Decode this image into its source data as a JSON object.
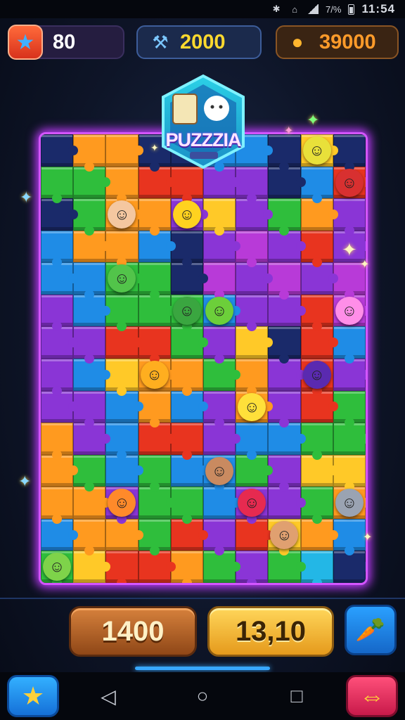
{
  "status_bar": {
    "battery_percent": "7/%",
    "time": "11:54"
  },
  "hud": {
    "stars": {
      "icon": "star-icon",
      "value": "80"
    },
    "gems": {
      "icon": "hammer-icon",
      "value": "2000"
    },
    "coins": {
      "icon": "coin-pot-icon",
      "value": "39000"
    }
  },
  "logo": {
    "title": "PUZZZIA"
  },
  "board": {
    "columns": 10,
    "rows": 14,
    "palette": {
      "G": "#2fbe3c",
      "O": "#ff9a1f",
      "Y": "#ffc928",
      "P": "#8a35d6",
      "B": "#1f8ce6",
      "R": "#e8341f",
      "D": "#1a2a6a",
      "M": "#b83ad8",
      "C": "#23b7e6"
    },
    "cells": [
      "DOODDBBDYD",
      "GGORRPPDBR",
      "DGOOPYPGOP",
      "BOOBDPMPRP",
      "BBGGDMPMPM",
      "PBGGGBPPRM",
      "PPRRGPYDRB",
      "PBYOOGOPRP",
      "PPBOBPOPRG",
      "OPBRRPBBGG",
      "OGBGBBGPYY",
      "OOPGGBPPGO",
      "BOOGRPRYOB",
      "GYRROGPGCD"
    ],
    "characters": [
      {
        "icon": "girl-character-icon",
        "row": 2,
        "col": 2,
        "color": "#f4c7a0"
      },
      {
        "icon": "bell-character-icon",
        "row": 2,
        "col": 4,
        "color": "#ffd21f"
      },
      {
        "icon": "yellow-monster-icon",
        "row": 0,
        "col": 8,
        "color": "#e8e03a"
      },
      {
        "icon": "red-hat-creature-icon",
        "row": 1,
        "col": 9,
        "color": "#d83030"
      },
      {
        "icon": "green-monster-icon",
        "row": 4,
        "col": 2,
        "color": "#52c44a"
      },
      {
        "icon": "pink-cat-icon",
        "row": 5,
        "col": 9,
        "color": "#ff8ee8"
      },
      {
        "icon": "green-monster-icon",
        "row": 5,
        "col": 4,
        "color": "#3aa640"
      },
      {
        "icon": "green-monster-icon",
        "row": 5,
        "col": 5,
        "color": "#6ccf3a"
      },
      {
        "icon": "orange-cat-icon",
        "row": 7,
        "col": 3,
        "color": "#ffae1f"
      },
      {
        "icon": "wizard-hat-icon",
        "row": 7,
        "col": 8,
        "color": "#5a2ab0"
      },
      {
        "icon": "yellow-star-creature-icon",
        "row": 8,
        "col": 6,
        "color": "#ffe03a"
      },
      {
        "icon": "boy-character-icon",
        "row": 10,
        "col": 5,
        "color": "#c98a60"
      },
      {
        "icon": "orange-blob-icon",
        "row": 11,
        "col": 2,
        "color": "#ff8a2a"
      },
      {
        "icon": "red-star-creature-icon",
        "row": 11,
        "col": 6,
        "color": "#e62a50"
      },
      {
        "icon": "grey-cat-icon",
        "row": 11,
        "col": 9,
        "color": "#9aa3b2"
      },
      {
        "icon": "boy-character-icon",
        "row": 12,
        "col": 7,
        "color": "#e0a070"
      },
      {
        "icon": "green-goblin-icon",
        "row": 13,
        "col": 0,
        "color": "#7ed34a"
      }
    ]
  },
  "bottom": {
    "left_button": "1400",
    "mid_button": "13,10",
    "tool_icon": "magic-wand-icon"
  },
  "nav": {
    "star_button_icon": "star-icon",
    "swap_button_icon": "swap-arrows-icon",
    "back_glyph": "◁",
    "home_glyph": "○",
    "recents_glyph": "□"
  }
}
